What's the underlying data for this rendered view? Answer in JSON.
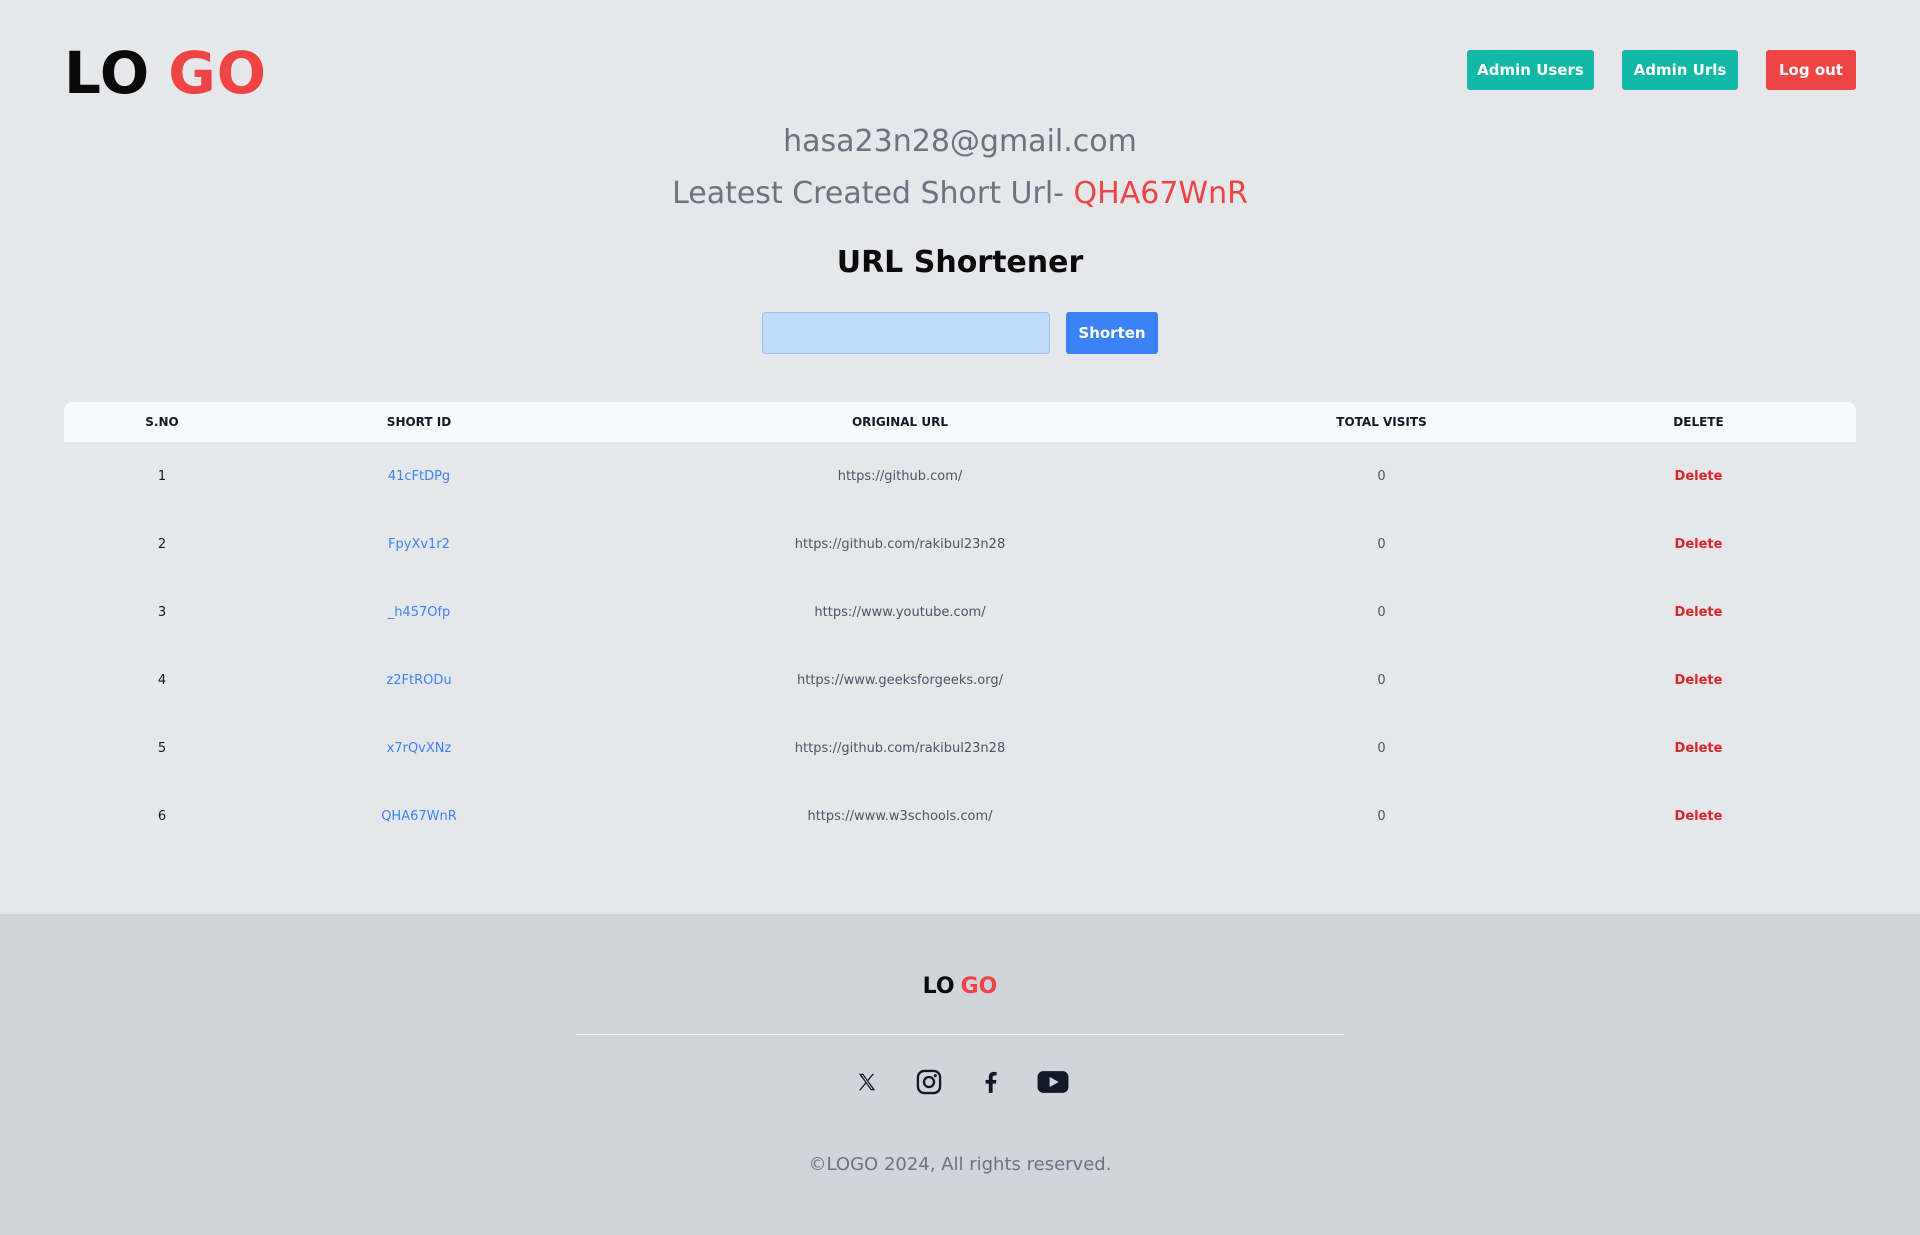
{
  "header": {
    "logo_part1": "LO",
    "logo_part2": "GO",
    "nav": {
      "admin_users": "Admin Users",
      "admin_urls": "Admin Urls",
      "logout": "Log out"
    }
  },
  "user": {
    "email": "hasa23n28@gmail.com",
    "latest_label": "Leatest Created Short Url-",
    "latest_code": "QHA67WnR"
  },
  "form": {
    "heading": "URL Shortener",
    "input_value": "",
    "button_label": "Shorten"
  },
  "table": {
    "columns": [
      "S.NO",
      "SHORT ID",
      "ORIGINAL URL",
      "TOTAL VISITS",
      "DELETE"
    ],
    "rows": [
      {
        "sno": "1",
        "short_id": "41cFtDPg",
        "url": "https://github.com/",
        "visits": "0",
        "action": "Delete"
      },
      {
        "sno": "2",
        "short_id": "FpyXv1r2",
        "url": "https://github.com/rakibul23n28",
        "visits": "0",
        "action": "Delete"
      },
      {
        "sno": "3",
        "short_id": "_h457Ofp",
        "url": "https://www.youtube.com/",
        "visits": "0",
        "action": "Delete"
      },
      {
        "sno": "4",
        "short_id": "z2FtRODu",
        "url": "https://www.geeksforgeeks.org/",
        "visits": "0",
        "action": "Delete"
      },
      {
        "sno": "5",
        "short_id": "x7rQvXNz",
        "url": "https://github.com/rakibul23n28",
        "visits": "0",
        "action": "Delete"
      },
      {
        "sno": "6",
        "short_id": "QHA67WnR",
        "url": "https://www.w3schools.com/",
        "visits": "0",
        "action": "Delete"
      }
    ]
  },
  "footer": {
    "logo_part1": "LO",
    "logo_part2": "GO",
    "socials": [
      "x-icon",
      "instagram-icon",
      "facebook-icon",
      "youtube-icon"
    ],
    "copyright": "©LOGO 2024, All rights reserved."
  },
  "colors": {
    "accent_red": "#ef4444",
    "teal": "#14b8a6",
    "blue": "#3b82f6"
  }
}
